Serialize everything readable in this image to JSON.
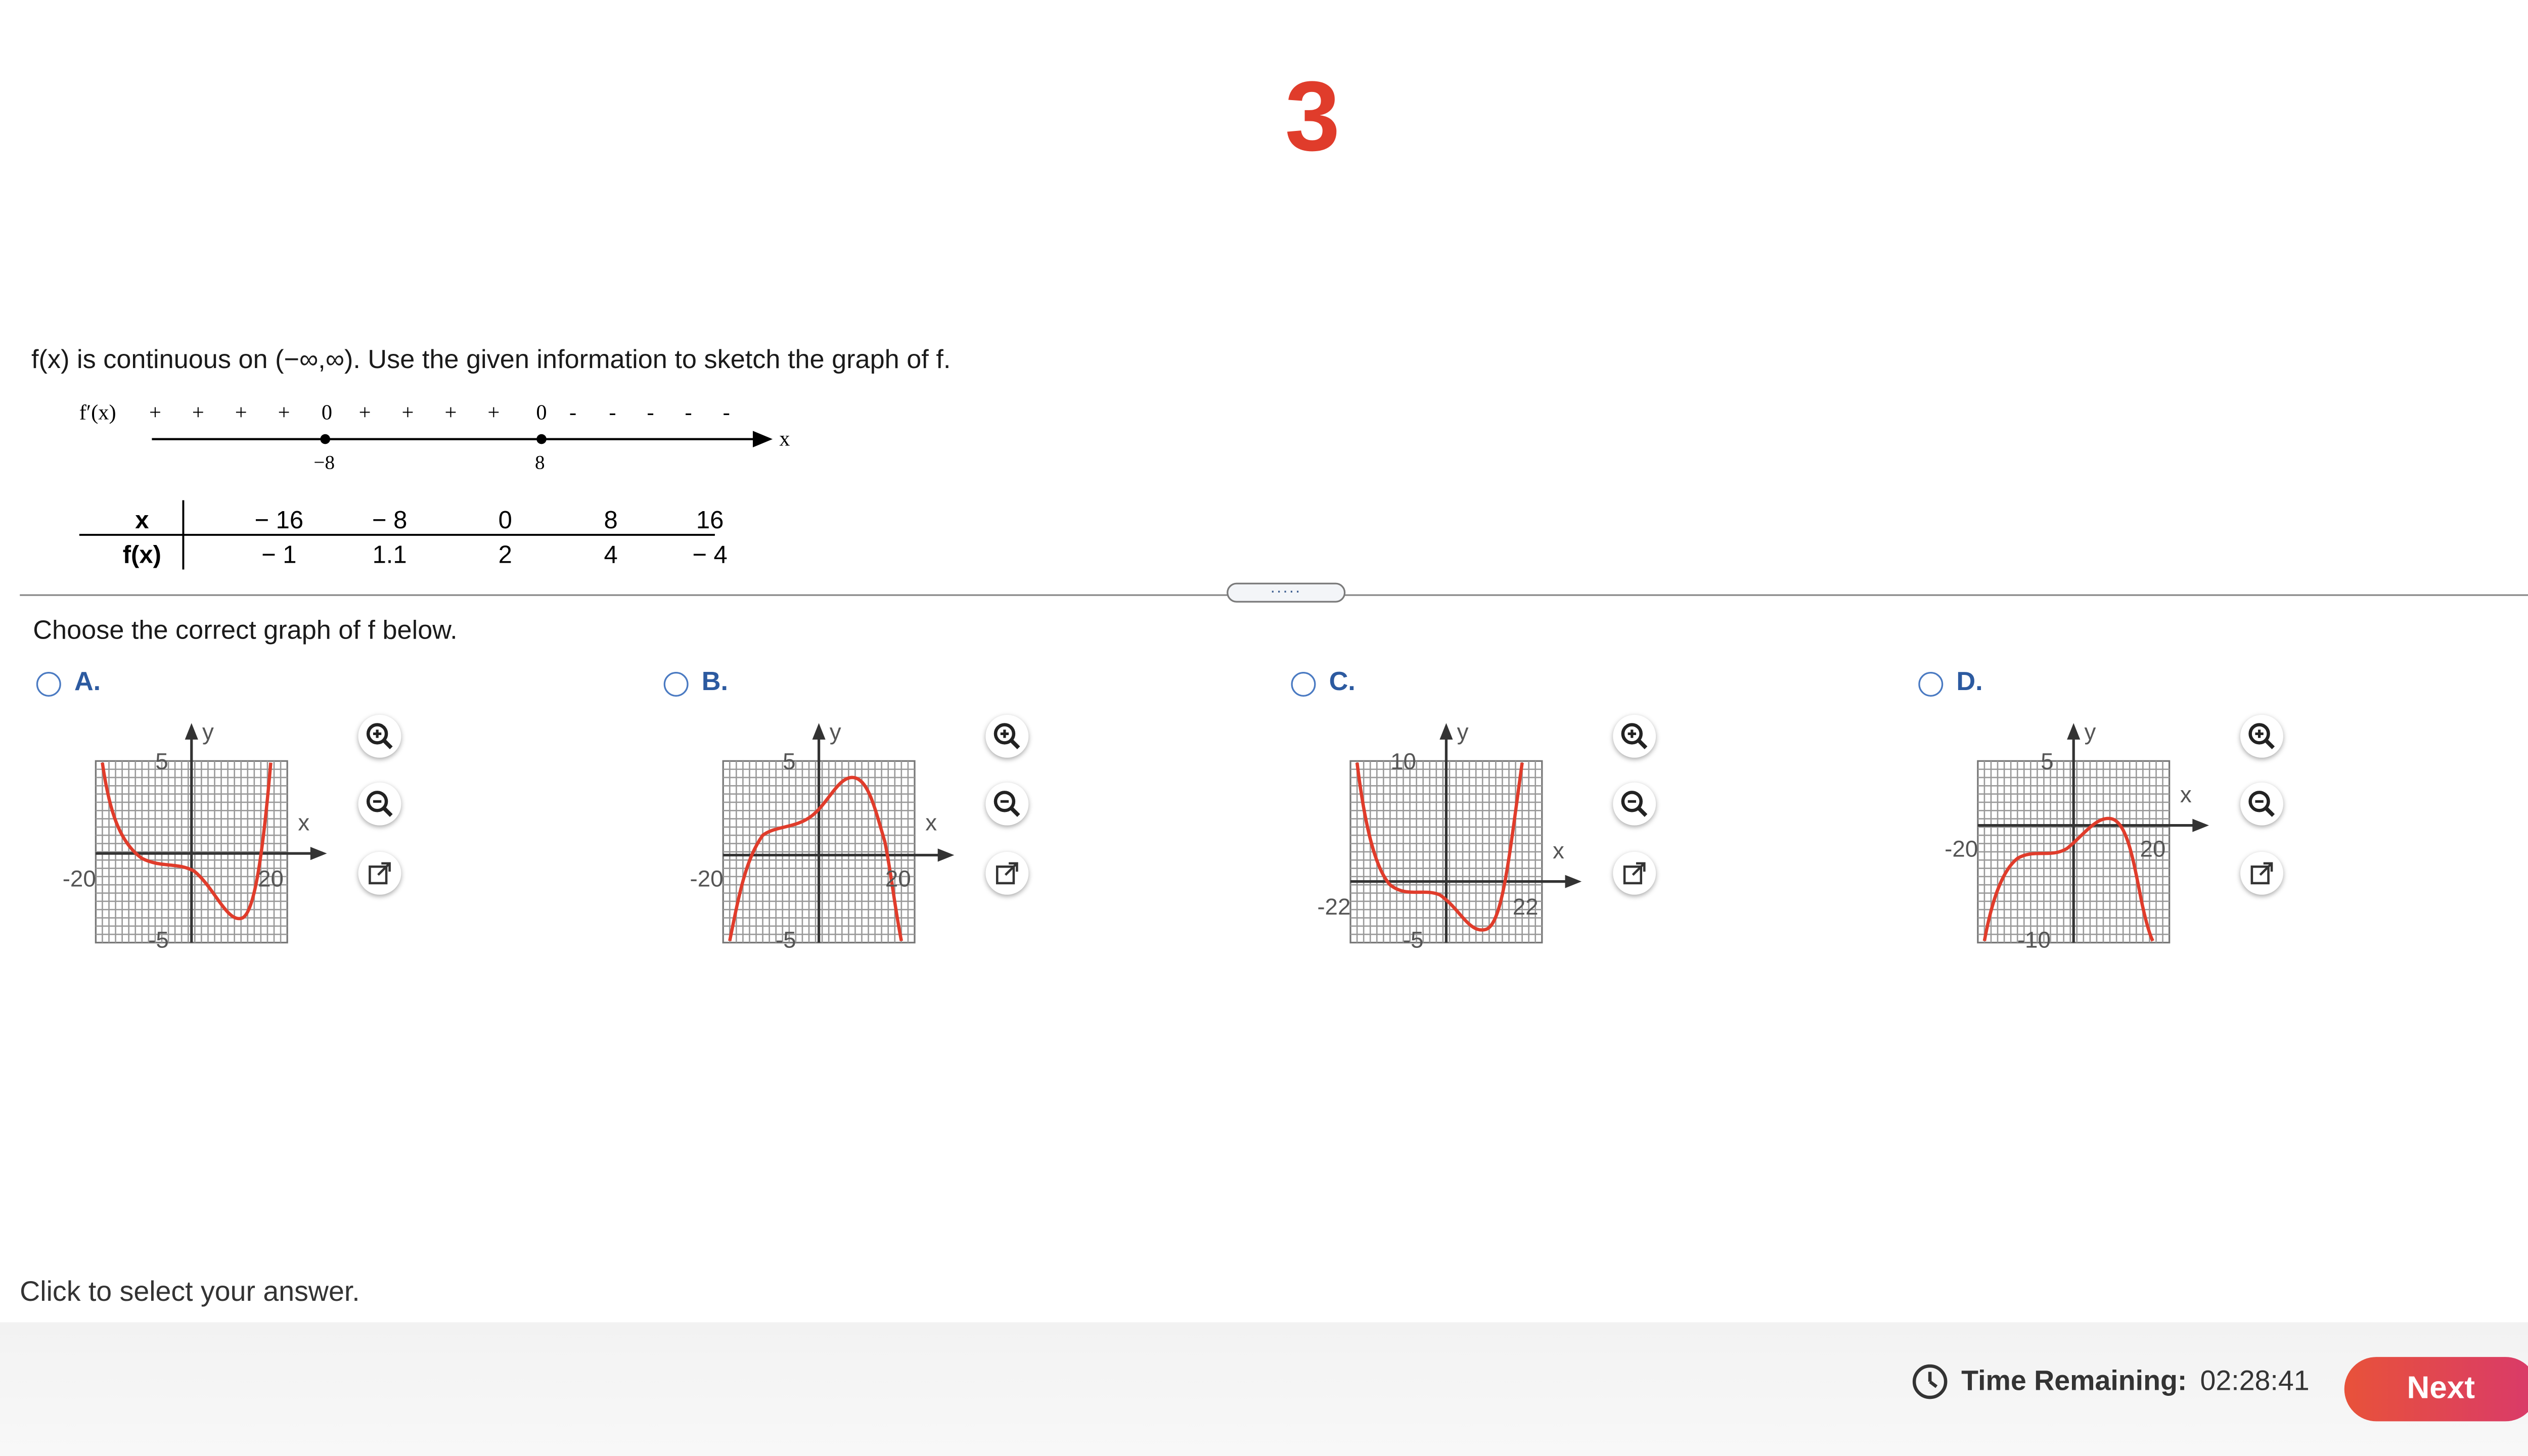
{
  "question_number": "3",
  "prompt": "f(x) is continuous on (−∞,∞).  Use the given information to sketch the graph of f.",
  "sign_chart": {
    "label": "f′(x)",
    "var": "x",
    "signs": [
      "+",
      "+",
      "+",
      "+",
      "0",
      "+",
      "+",
      "+",
      "+",
      "0",
      "-",
      "-",
      "-",
      "-",
      "-"
    ],
    "critical_points": [
      "−8",
      "8"
    ]
  },
  "value_table": {
    "headers": [
      "x",
      "f(x)"
    ],
    "x": [
      "− 16",
      "− 8",
      "0",
      "8",
      "16"
    ],
    "fx": [
      "− 1",
      "1.1",
      "2",
      "4",
      "− 4"
    ]
  },
  "drag_handle": ".....",
  "choose_text": "Choose the correct graph of f below.",
  "options": [
    {
      "letter": "A.",
      "xtick_left": "-20",
      "xtick_right": "20",
      "ytick_top": "5",
      "ytick_bottom": "-5",
      "xlabel": "x",
      "ylabel": "y"
    },
    {
      "letter": "B.",
      "xtick_left": "-20",
      "xtick_right": "20",
      "ytick_top": "5",
      "ytick_bottom": "-5",
      "xlabel": "x",
      "ylabel": "y"
    },
    {
      "letter": "C.",
      "xtick_left": "-22",
      "xtick_right": "22",
      "ytick_top": "10",
      "ytick_bottom": "-5",
      "xlabel": "x",
      "ylabel": "y"
    },
    {
      "letter": "D.",
      "xtick_left": "-20",
      "xtick_right": "20",
      "ytick_top": "5",
      "ytick_bottom": "-10",
      "xlabel": "x",
      "ylabel": "y"
    }
  ],
  "tool_icons": [
    "zoom-in-icon",
    "zoom-out-icon",
    "open-external-icon"
  ],
  "footer_note": "Click to select your answer.",
  "timer": {
    "label": "Time Remaining:",
    "value": "02:28:41"
  },
  "next_label": "Next",
  "colors": {
    "accent": "#e03c2b",
    "option_blue": "#2c5aa0",
    "curve": "#e03c2b",
    "next_start": "#e8523a",
    "next_end": "#d93a6a"
  }
}
